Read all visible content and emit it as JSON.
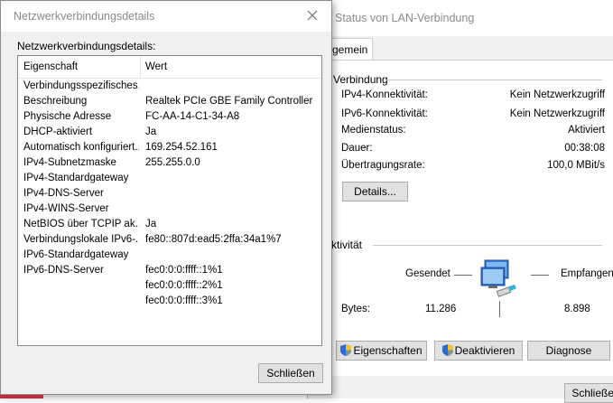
{
  "back_window": {
    "title": "Status von LAN-Verbindung",
    "tab": "gemein",
    "connection_group": "Verbindung",
    "rows": [
      {
        "label": "IPv4-Konnektivität:",
        "value": "Kein Netzwerkzugriff"
      },
      {
        "label": "IPv6-Konnektivität:",
        "value": "Kein Netzwerkzugriff"
      },
      {
        "label": "Medienstatus:",
        "value": "Aktiviert"
      },
      {
        "label": "Dauer:",
        "value": "00:38:08"
      },
      {
        "label": "Übertragungsrate:",
        "value": "100,0 MBit/s"
      }
    ],
    "details_button": "Details...",
    "activity_group": "ktivität",
    "sent_label": "Gesendet",
    "received_label": "Empfangen",
    "bytes_label": "Bytes:",
    "bytes_sent": "11.286",
    "bytes_received": "8.898",
    "properties_button": "Eigenschaften",
    "disable_button": "Deaktivieren",
    "diagnose_button": "Diagnose",
    "close_button": "Schließen"
  },
  "dialog": {
    "title": "Netzwerkverbindungsdetails",
    "label": "Netzwerkverbindungsdetails:",
    "columns": [
      "Eigenschaft",
      "Wert"
    ],
    "rows": [
      {
        "property": "Verbindungsspezifisches...",
        "value": ""
      },
      {
        "property": "Beschreibung",
        "value": "Realtek PCIe GBE Family Controller"
      },
      {
        "property": "Physische Adresse",
        "value": "FC-AA-14-C1-34-A8"
      },
      {
        "property": "DHCP-aktiviert",
        "value": "Ja"
      },
      {
        "property": "Automatisch konfiguriert...",
        "value": "169.254.52.161"
      },
      {
        "property": "IPv4-Subnetzmaske",
        "value": "255.255.0.0"
      },
      {
        "property": "IPv4-Standardgateway",
        "value": ""
      },
      {
        "property": "IPv4-DNS-Server",
        "value": ""
      },
      {
        "property": "IPv4-WINS-Server",
        "value": ""
      },
      {
        "property": "NetBIOS über TCPIP ak...",
        "value": "Ja"
      },
      {
        "property": "Verbindungslokale IPv6-...",
        "value": "fe80::807d:ead5:2ffa:34a1%7"
      },
      {
        "property": "IPv6-Standardgateway",
        "value": ""
      },
      {
        "property": "IPv6-DNS-Server",
        "value": "fec0:0:0:ffff::1%1"
      },
      {
        "property": "",
        "value": "fec0:0:0:ffff::2%1"
      },
      {
        "property": "",
        "value": "fec0:0:0:ffff::3%1"
      }
    ],
    "close_button": "Schließen"
  }
}
